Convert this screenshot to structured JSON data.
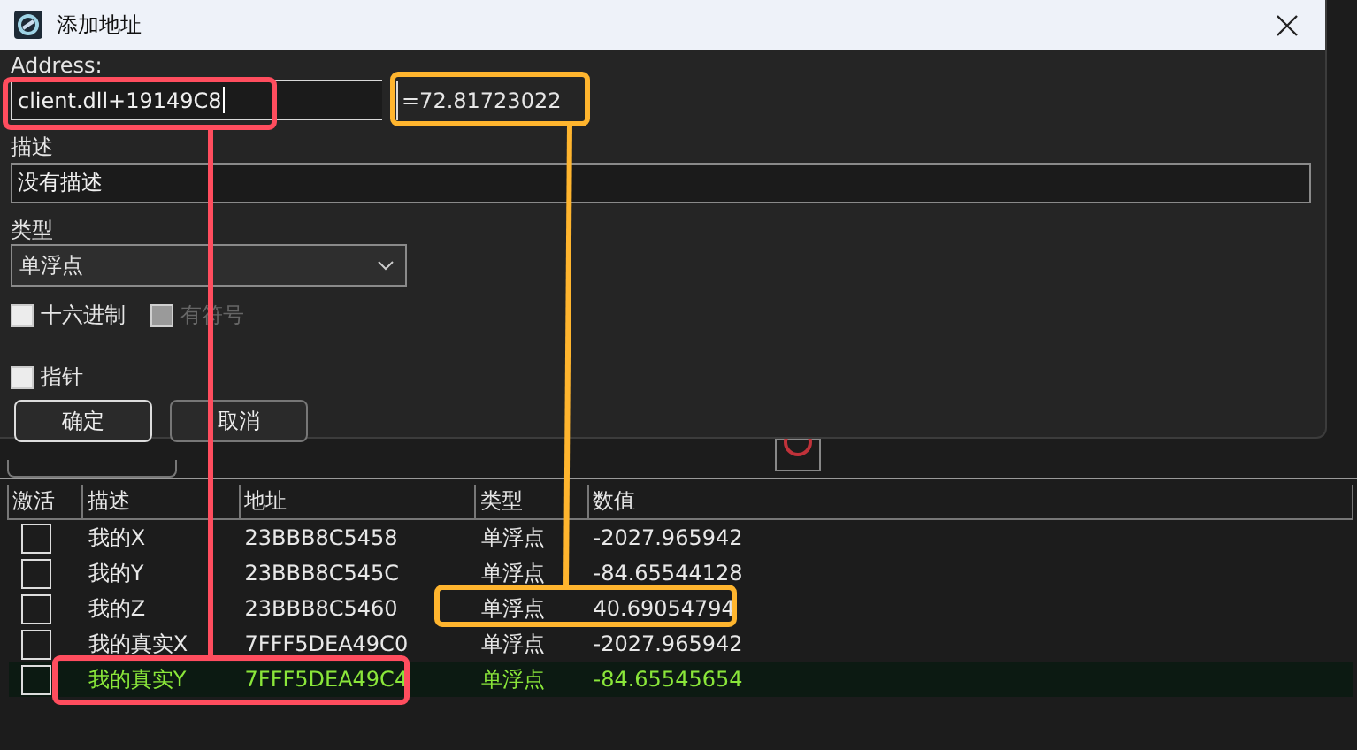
{
  "dialog": {
    "title": "添加地址",
    "address_label": "Address:",
    "address": {
      "value": "client.dll+19149C8"
    },
    "resolved_value": "=72.81723022",
    "description_label": "描述",
    "description": {
      "value": "没有描述"
    },
    "type_label": "类型",
    "type_select": {
      "value": "单浮点"
    },
    "options": [
      {
        "label": "十六进制",
        "checked": false,
        "disabled": false
      },
      {
        "label": "有符号",
        "checked": false,
        "disabled": true
      },
      {
        "label": "指针",
        "checked": false,
        "disabled": false
      }
    ],
    "buttons": [
      {
        "label": "确定",
        "selected": true
      },
      {
        "label": "取消",
        "selected": false
      }
    ]
  },
  "table": {
    "columns": [
      "激活",
      "描述",
      "地址",
      "类型",
      "数值"
    ],
    "rows": [
      {
        "active": false,
        "description": "我的X",
        "address": "23BBB8C5458",
        "type": "单浮点",
        "value": "-2027.965942",
        "selected": false
      },
      {
        "active": false,
        "description": "我的Y",
        "address": "23BBB8C545C",
        "type": "单浮点",
        "value": "-84.65544128",
        "selected": false
      },
      {
        "active": false,
        "description": "我的Z",
        "address": "23BBB8C5460",
        "type": "单浮点",
        "value": "40.69054794",
        "selected": false
      },
      {
        "active": false,
        "description": "我的真实X",
        "address": "7FFF5DEA49C0",
        "type": "单浮点",
        "value": "-2027.965942",
        "selected": false
      },
      {
        "active": false,
        "description": "我的真实Y",
        "address": "7FFF5DEA49C4",
        "type": "单浮点",
        "value": "-84.65545654",
        "selected": true
      }
    ]
  },
  "annotations": [
    {
      "color": "#ff4d5e"
    },
    {
      "color": "#ffb52e"
    }
  ]
}
